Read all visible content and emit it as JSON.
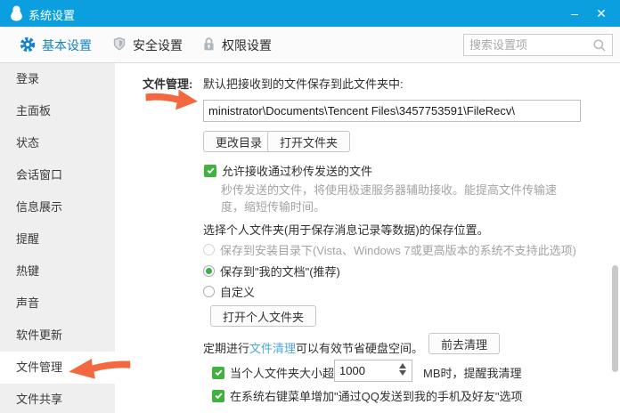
{
  "window": {
    "title": "系统设置"
  },
  "titlebar": {
    "minimize_glyph": "–",
    "close_glyph": "✕"
  },
  "tabs": [
    {
      "label": "基本设置",
      "icon": "gear-icon",
      "active": true
    },
    {
      "label": "安全设置",
      "icon": "shield-icon",
      "active": false
    },
    {
      "label": "权限设置",
      "icon": "lock-icon",
      "active": false
    }
  ],
  "search": {
    "placeholder": "搜索设置项",
    "icon": "search-icon"
  },
  "sidebar": {
    "items": [
      {
        "label": "登录"
      },
      {
        "label": "主面板"
      },
      {
        "label": "状态"
      },
      {
        "label": "会话窗口"
      },
      {
        "label": "信息展示"
      },
      {
        "label": "提醒"
      },
      {
        "label": "热键"
      },
      {
        "label": "声音"
      },
      {
        "label": "软件更新"
      },
      {
        "label": "文件管理",
        "active": true
      },
      {
        "label": "文件共享"
      }
    ]
  },
  "content": {
    "section_label": "文件管理:",
    "default_folder_text": "默认把接收到的文件保存到此文件夹中:",
    "path_value": "ministrator\\Documents\\Tencent Files\\3457753591\\FileRecv\\",
    "change_dir_button": "更改目录",
    "open_folder_button": "打开文件夹",
    "quick_transfer": {
      "checked": true,
      "label": "允许接收通过秒传发送的文件",
      "desc_line1": "秒传发送的文件，将使用极速服务器辅助接收。能提高文件传输速",
      "desc_line2": "度，缩短传输时间。"
    },
    "personal_folder": {
      "heading": "选择个人文件夹(用于保存消息记录等数据)的保存位置。",
      "options": [
        {
          "label": "保存到安装目录下(Vista、Windows 7或更高版本的系统不支持此选项)",
          "state": "disabled"
        },
        {
          "label": "保存到\"我的文档\"(推荐)",
          "state": "selected"
        },
        {
          "label": "自定义",
          "state": "unselected"
        }
      ],
      "open_button": "打开个人文件夹"
    },
    "cleanup": {
      "prefix": "定期进行",
      "link": "文件清理",
      "suffix": "可以有效节省硬盘空间。",
      "button": "前去清理"
    },
    "size_alert": {
      "checked": true,
      "before": "当个人文件夹大小超过",
      "value": "1000",
      "after": "MB时，提醒我清理"
    },
    "context_menu": {
      "checked": true,
      "label": "在系统右键菜单增加\"通过QQ发送到我的手机及好友\"选项"
    }
  },
  "colors": {
    "titlebar": "#0b9fe0",
    "accent_blue": "#1583c7",
    "check_green": "#42b140",
    "radio_green": "#3fae49",
    "annotation_orange": "#f4683f",
    "link_blue": "#4da6dd"
  }
}
